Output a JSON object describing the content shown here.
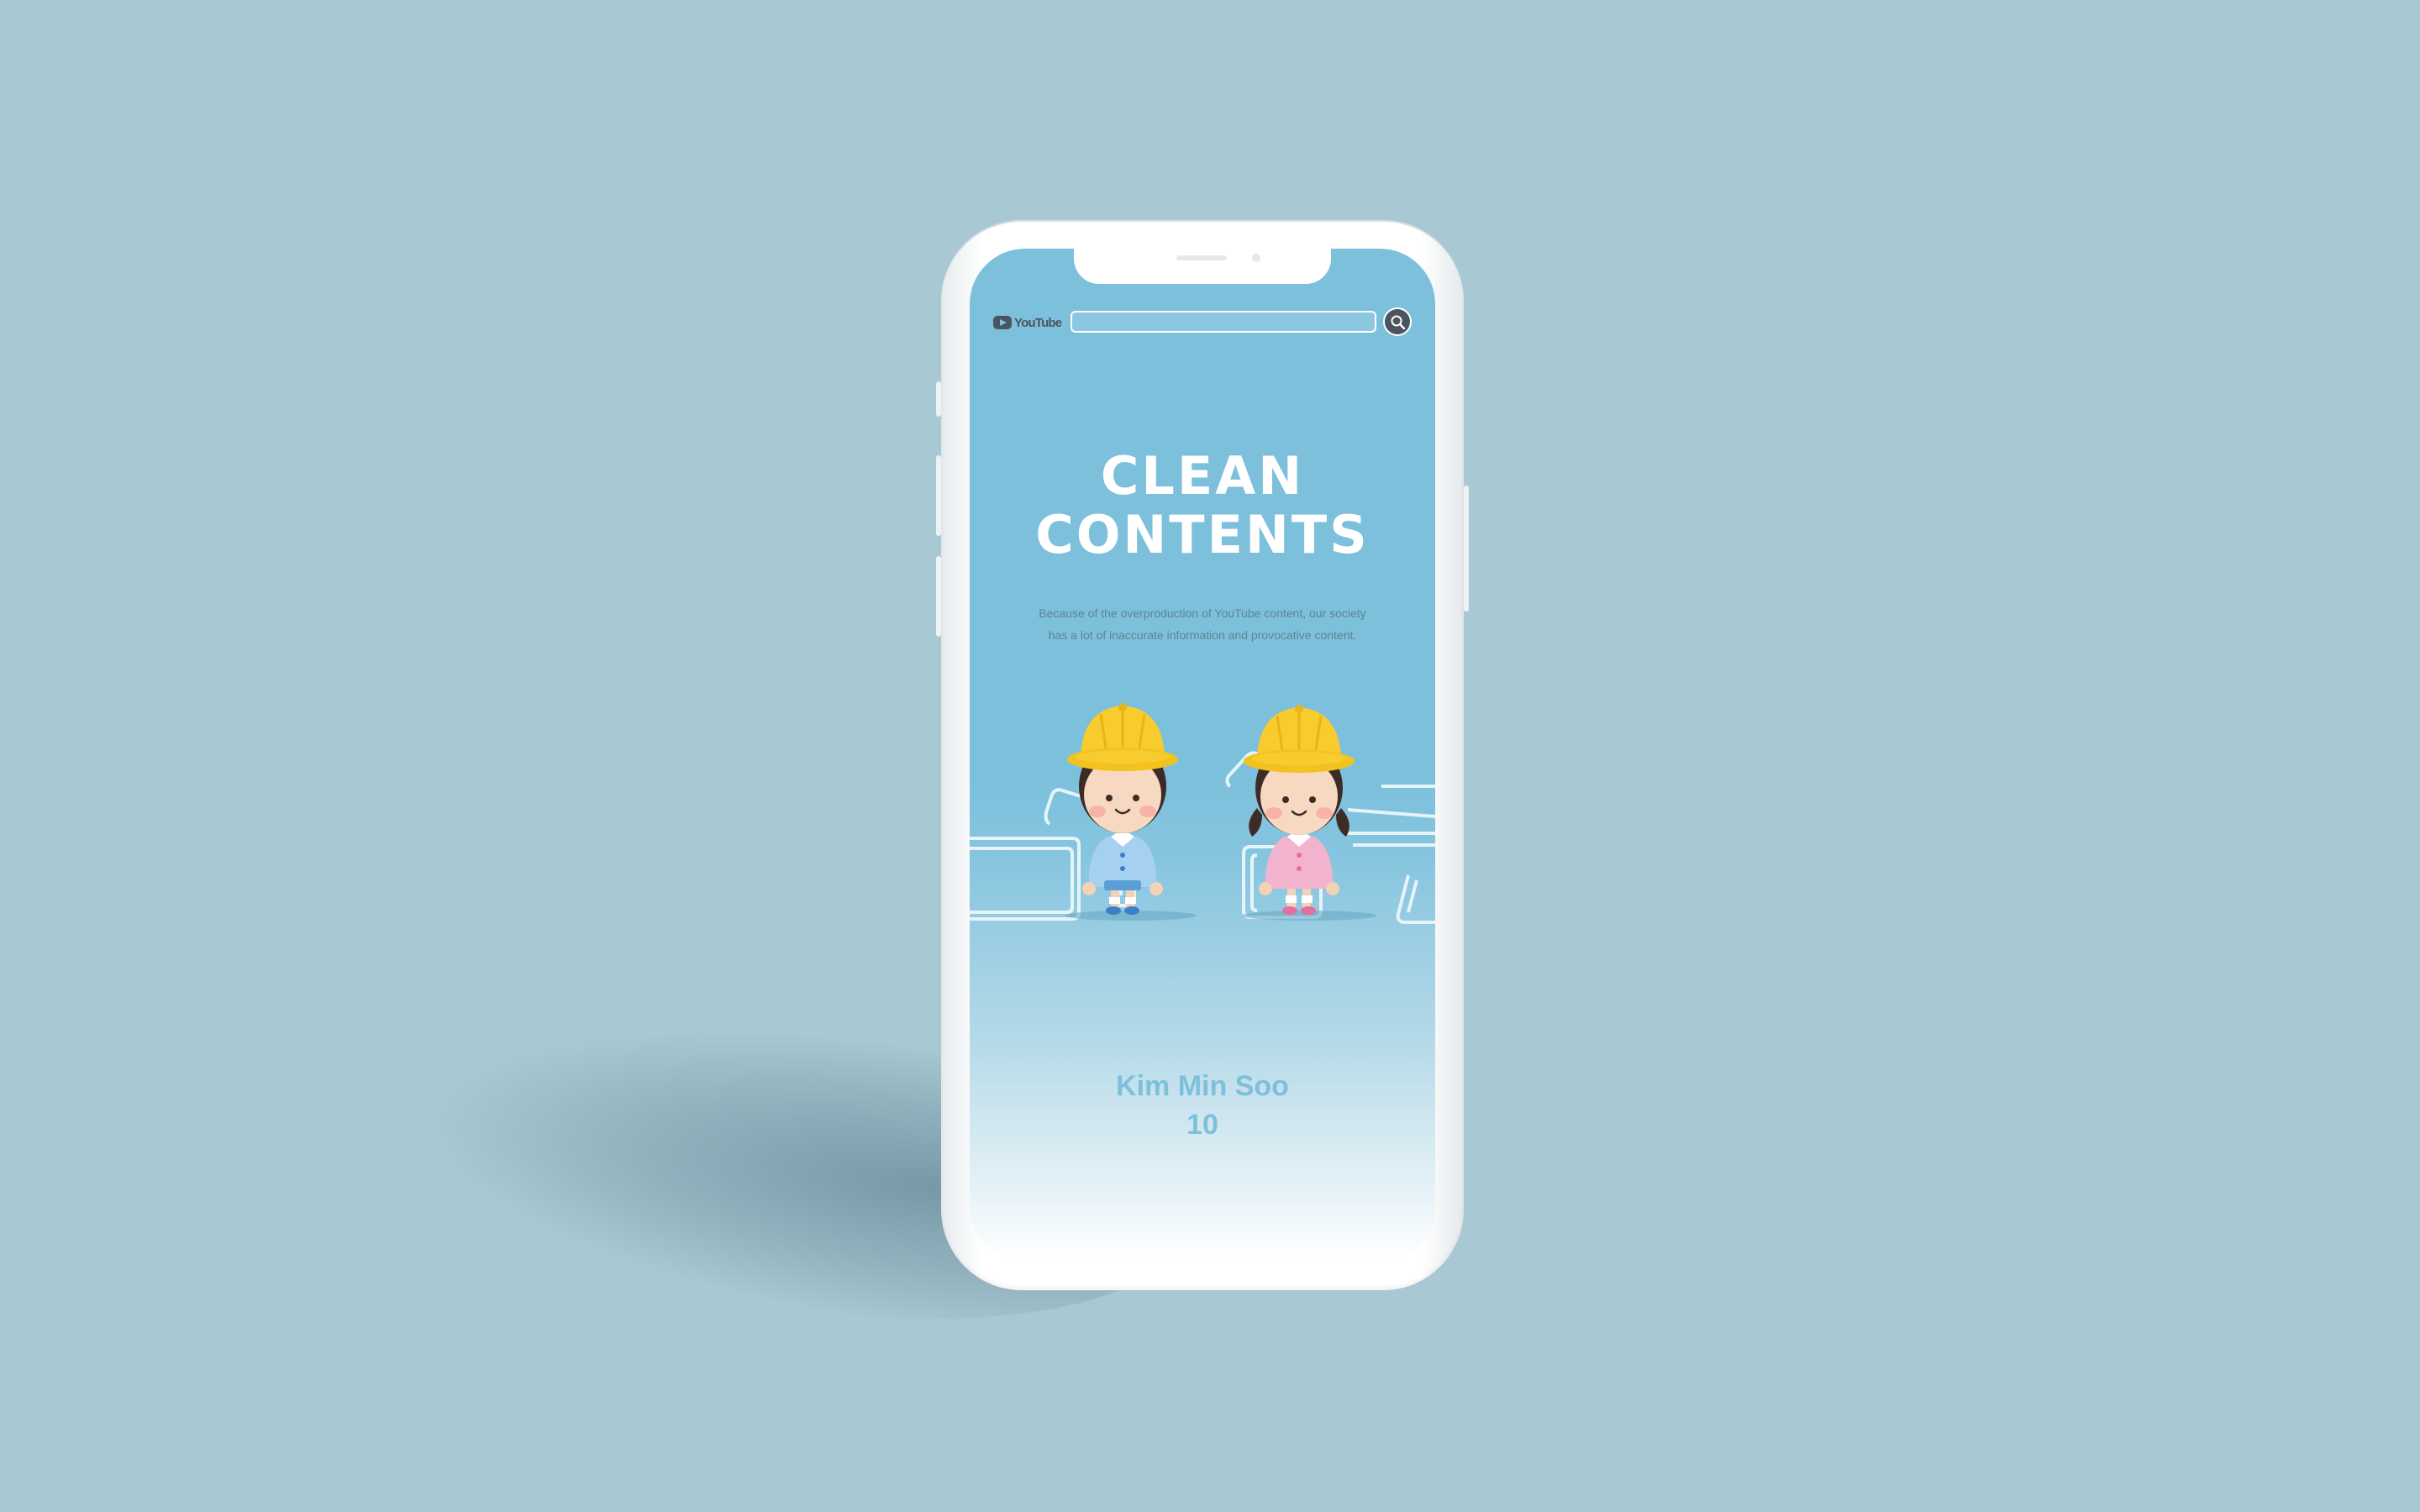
{
  "background_color": "#a8c8d3",
  "screen": {
    "accent_color": "#7cc0dc",
    "header": {
      "logo_text": "YouTube",
      "logo_icon": "youtube-play-icon",
      "search_placeholder": "",
      "search_icon": "magnifier-icon"
    },
    "headline": {
      "line1": "CLEAN",
      "line2": "CONTENTS"
    },
    "description": {
      "line1": "Because of the overproduction of YouTube content, our society",
      "line2": "has a lot of inaccurate information and provocative content."
    },
    "illustration": {
      "characters": [
        "boy-in-yellow-hat",
        "girl-in-yellow-hat"
      ]
    },
    "author": {
      "name": "Kim Min Soo",
      "number": "10"
    }
  }
}
